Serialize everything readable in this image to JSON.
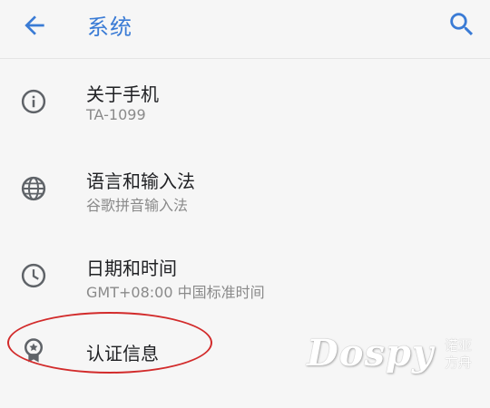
{
  "header": {
    "title": "系统",
    "back_icon": "arrow-back-icon",
    "search_icon": "search-icon"
  },
  "items": [
    {
      "icon": "info-icon",
      "title": "关于手机",
      "subtitle": "TA-1099"
    },
    {
      "icon": "globe-icon",
      "title": "语言和输入法",
      "subtitle": "谷歌拼音输入法"
    },
    {
      "icon": "clock-icon",
      "title": "日期和时间",
      "subtitle": "GMT+08:00 中国标准时间"
    },
    {
      "icon": "certificate-icon",
      "title": "认证信息"
    }
  ],
  "watermark": {
    "main": "Dospy",
    "side_top": "诺亚",
    "side_bottom": "方舟"
  },
  "colors": {
    "accent": "#3a7bd5",
    "annotation": "#d22b2b",
    "icon": "#5f6368"
  }
}
